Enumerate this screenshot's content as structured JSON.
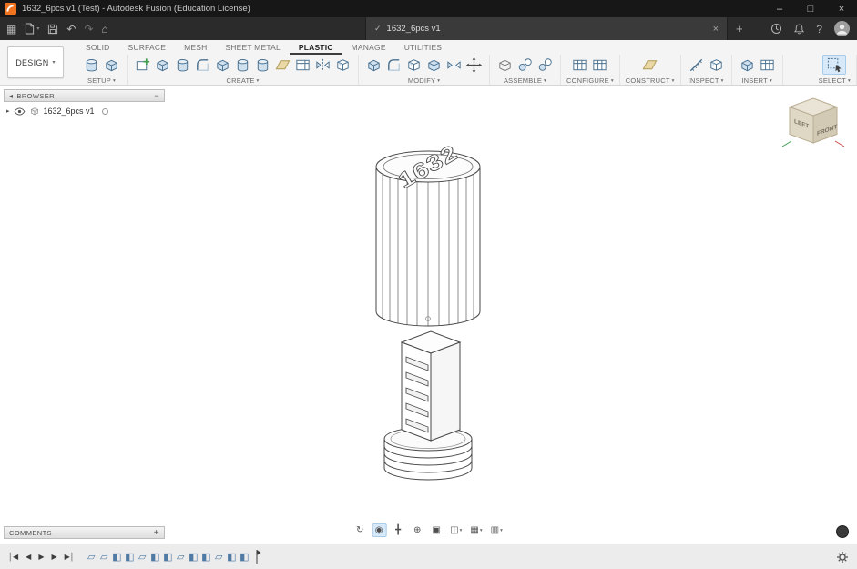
{
  "window": {
    "title": "1632_6pcs v1 (Test) - Autodesk Fusion (Education License)",
    "minimize_glyph": "–",
    "maximize_glyph": "□",
    "close_glyph": "×"
  },
  "appbar": {
    "apps_glyph": "▦",
    "file_caret": "▾",
    "undo_glyph": "↶",
    "redo_glyph": "↷",
    "home_glyph": "⌂",
    "tab": {
      "check_glyph": "✓",
      "label": "1632_6pcs v1",
      "close_glyph": "×"
    },
    "new_tab_glyph": "+",
    "help_glyph": "?"
  },
  "ribbon": {
    "design_label": "DESIGN",
    "caret_glyph": "▾",
    "tabs": [
      "SOLID",
      "SURFACE",
      "MESH",
      "SHEET METAL",
      "PLASTIC",
      "MANAGE",
      "UTILITIES"
    ],
    "active_tab": "PLASTIC",
    "groups": [
      "SETUP",
      "CREATE",
      "MODIFY",
      "ASSEMBLE",
      "CONFIGURE",
      "CONSTRUCT",
      "INSPECT",
      "INSERT",
      "SELECT"
    ]
  },
  "browser": {
    "collapse_glyph": "◂",
    "header": "BROWSER",
    "minimize_glyph": "−",
    "item_caret_glyph": "▸",
    "item_label": "1632_6pcs v1"
  },
  "model": {
    "top_text": "1632"
  },
  "viewcube": {
    "left": "LEFT",
    "front": "FRONT"
  },
  "navbar": {
    "orbit_glyph": "↻",
    "look_at_glyph": "◉",
    "pan_glyph": "╋",
    "zoom_glyph": "⊕",
    "fit_glyph": "▣",
    "display_glyph": "◫",
    "grid_glyph": "▦",
    "viewports_glyph": "▥",
    "caret_glyph": "▾"
  },
  "comments": {
    "header": "COMMENTS",
    "add_glyph": "+"
  },
  "timeline": {
    "controls": [
      "│◀",
      "◀",
      "▶",
      "▶",
      "▶│"
    ],
    "features": [
      "▱",
      "▱",
      "◧",
      "◧",
      "▱",
      "◧",
      "◧",
      "▱",
      "◧",
      "◧",
      "▱",
      "◧",
      "◧"
    ]
  },
  "colors": {
    "accent_orange": "#f0731f",
    "icon_blue": "#49708f",
    "highlight_blue": "#d8eafa"
  }
}
